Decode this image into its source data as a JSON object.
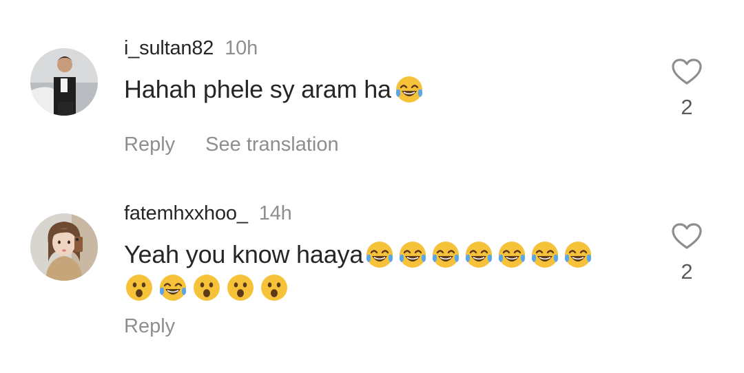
{
  "comments": [
    {
      "username": "i_sultan82",
      "time": "10h",
      "text": "Hahah phele sy aram ha",
      "emojis": [
        "face-with-tears-of-joy"
      ],
      "reply_label": "Reply",
      "translate_label": "See translation",
      "like_count": "2",
      "like_icon": "heart-outline-icon"
    },
    {
      "username": "fatemhxxhoo_",
      "time": "14h",
      "text": "Yeah you know haaya",
      "emojis_line1": [
        "face-with-tears-of-joy",
        "face-with-tears-of-joy",
        "face-with-tears-of-joy",
        "face-with-tears-of-joy",
        "face-with-tears-of-joy",
        "face-with-tears-of-joy",
        "face-with-tears-of-joy"
      ],
      "emojis_line2": [
        "face-with-open-mouth",
        "face-with-tears-of-joy",
        "face-with-open-mouth",
        "face-with-open-mouth",
        "face-with-open-mouth"
      ],
      "reply_label": "Reply",
      "like_count": "2",
      "like_icon": "heart-outline-icon"
    }
  ],
  "colors": {
    "primary_text": "#262626",
    "secondary_text": "#8e8e8e",
    "emoji_yellow": "#f6c23a",
    "tear_blue": "#5aa6e6"
  }
}
